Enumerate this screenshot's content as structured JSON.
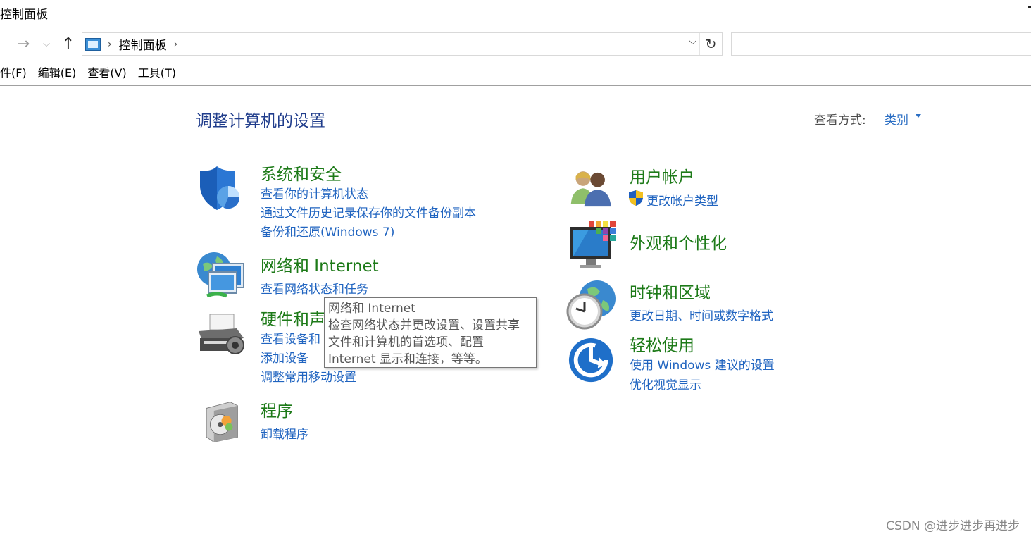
{
  "window": {
    "title": "控制面板"
  },
  "nav": {
    "forward_icon": "arrow-right-icon",
    "recent_icon": "chevron-down-icon",
    "up_icon": "arrow-up-icon",
    "address": {
      "crumb": "控制面板",
      "sep": "›",
      "dropdown": "⌵",
      "refresh": "↻"
    },
    "search": {
      "placeholder": ""
    }
  },
  "menu": [
    "件(F)",
    "编辑(E)",
    "查看(V)",
    "工具(T)"
  ],
  "main": {
    "page_title": "调整计算机的设置",
    "view_by_label": "查看方式:",
    "view_by_value": "类别"
  },
  "categories": {
    "system_security": {
      "title": "系统和安全",
      "links": [
        "查看你的计算机状态",
        "通过文件历史记录保存你的文件备份副本",
        "备份和还原(Windows 7)"
      ]
    },
    "network_internet": {
      "title": "网络和 Internet",
      "links": [
        "查看网络状态和任务"
      ]
    },
    "hardware_sound": {
      "title": "硬件和声",
      "links": [
        "查看设备和",
        "添加设备",
        "调整常用移动设置"
      ]
    },
    "programs": {
      "title": "程序",
      "links": [
        "卸载程序"
      ]
    },
    "user_accounts": {
      "title": "用户帐户",
      "links": [
        "更改帐户类型"
      ]
    },
    "appearance": {
      "title": "外观和个性化",
      "links": []
    },
    "clock_region": {
      "title": "时钟和区域",
      "links": [
        "更改日期、时间或数字格式"
      ]
    },
    "ease_of_access": {
      "title": "轻松使用",
      "links": [
        "使用 Windows 建议的设置",
        "优化视觉显示"
      ]
    }
  },
  "tooltip": {
    "lines": [
      "网络和 Internet",
      "检查网络状态并更改设置、设置共享",
      "文件和计算机的首选项、配置",
      "Internet 显示和连接，等等。"
    ]
  },
  "watermark": "CSDN @进步进步再进步",
  "colors": {
    "title_blue": "#1f3c8b",
    "category_green": "#1d7a18",
    "link_blue": "#2064c0"
  }
}
